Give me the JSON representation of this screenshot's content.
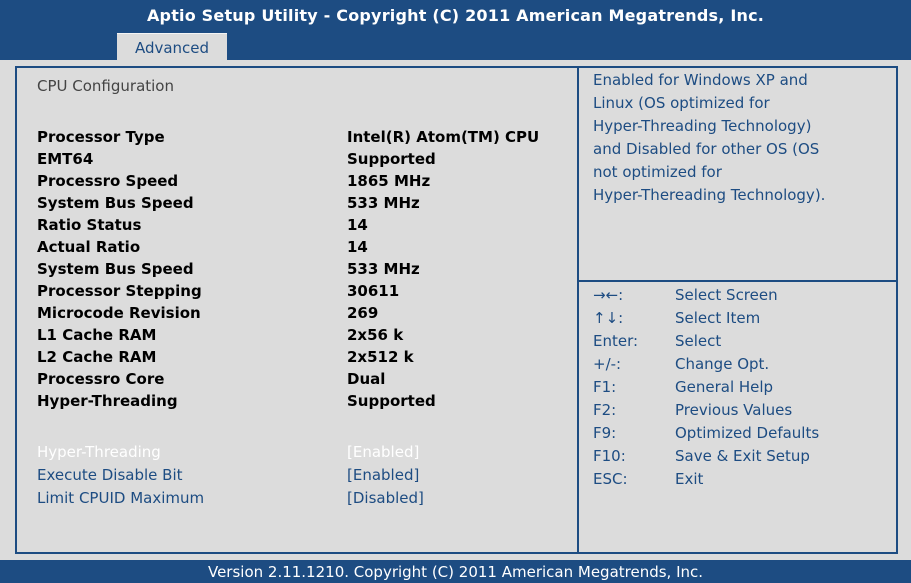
{
  "header": {
    "title": "Aptio Setup Utility - Copyright (C) 2011 American Megatrends, Inc.",
    "active_tab": "Advanced"
  },
  "main": {
    "section_title": "CPU Configuration",
    "info_rows": [
      {
        "label": "Processor Type",
        "value": "Intel(R) Atom(TM) CPU"
      },
      {
        "label": "EMT64",
        "value": "Supported"
      },
      {
        "label": "Processro Speed",
        "value": "1865 MHz"
      },
      {
        "label": "System Bus Speed",
        "value": "533 MHz"
      },
      {
        "label": "Ratio Status",
        "value": "14"
      },
      {
        "label": "Actual Ratio",
        "value": "14"
      },
      {
        "label": "System Bus Speed",
        "value": "533 MHz"
      },
      {
        "label": "Processor Stepping",
        "value": "30611"
      },
      {
        "label": "Microcode Revision",
        "value": "269"
      },
      {
        "label": "L1 Cache RAM",
        "value": "2x56 k"
      },
      {
        "label": "L2 Cache RAM",
        "value": "2x512 k"
      },
      {
        "label": "Processro Core",
        "value": "Dual"
      },
      {
        "label": "Hyper-Threading",
        "value": "Supported"
      }
    ],
    "option_rows": [
      {
        "label": "Hyper-Threading",
        "value": "[Enabled]",
        "selected": true
      },
      {
        "label": "Execute Disable Bit",
        "value": "[Enabled]",
        "selected": false
      },
      {
        "label": "Limit CPUID Maximum",
        "value": "[Disabled]",
        "selected": false
      }
    ]
  },
  "help": {
    "lines": [
      "Enabled for Windows XP and",
      "Linux (OS optimized for",
      "Hyper-Threading Technology)",
      "and Disabled for other OS (OS",
      "not optimized for",
      "Hyper-Thereading Technology)."
    ]
  },
  "keys": [
    {
      "key": "→←:",
      "desc": "Select Screen"
    },
    {
      "key": "↑↓:",
      "desc": "Select Item"
    },
    {
      "key": "Enter:",
      "desc": "Select"
    },
    {
      "key": "+/-:",
      "desc": "Change Opt."
    },
    {
      "key": "F1:",
      "desc": "General Help"
    },
    {
      "key": "F2:",
      "desc": "Previous Values"
    },
    {
      "key": "F9:",
      "desc": "Optimized Defaults"
    },
    {
      "key": "F10:",
      "desc": "Save & Exit Setup"
    },
    {
      "key": "ESC:",
      "desc": "Exit"
    }
  ],
  "footer": {
    "text": "Version 2.11.1210. Copyright (C) 2011 American Megatrends, Inc."
  },
  "colors": {
    "primary_blue": "#1d4c82",
    "panel_gray": "#dcdcdc",
    "highlight_white": "#ffffff"
  }
}
